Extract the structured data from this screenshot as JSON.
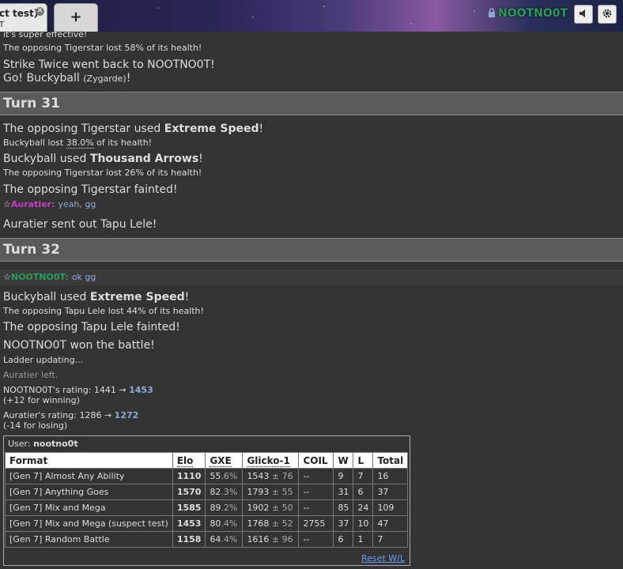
{
  "tabs": {
    "active_title": "ct test)",
    "active_sub": "T",
    "plus": "+"
  },
  "header": {
    "username": "NOOTNO0T",
    "sound_icon": "speaker-icon",
    "settings_icon": "gear-icon",
    "user_color": "#2a9a5a"
  },
  "log": {
    "l0": "it's super effective!",
    "l1": "The opposing Tigerstar lost 58% of its health!",
    "l2": "Strike Twice went back to NOOTNO0T!",
    "l3a": "Go! Buckyball ",
    "l3b": "(Zygarde)",
    "l3c": "!",
    "turn31": "Turn 31",
    "l4a": "The opposing Tigerstar used ",
    "l4b": "Extreme Speed",
    "l4c": "!",
    "l5a": "Buckyball lost ",
    "l5b": "38.0%",
    "l5c": " of its health!",
    "l6a": "Buckyball used ",
    "l6b": "Thousand Arrows",
    "l6c": "!",
    "l7": "The opposing Tigerstar lost 26% of its health!",
    "l8": "The opposing Tigerstar fainted!",
    "chat1": {
      "star": "☆",
      "name": "Auratier:",
      "msg": "yeah, gg",
      "color": "#c040c0"
    },
    "l9": "Auratier sent out Tapu Lele!",
    "turn32": "Turn 32",
    "chat2": {
      "star": "☆",
      "name": "NOOTNO0T:",
      "msg": "ok gg",
      "color": "#2a9a5a"
    },
    "l10a": "Buckyball used ",
    "l10b": "Extreme Speed",
    "l10c": "!",
    "l11": "The opposing Tapu Lele lost 44% of its health!",
    "l12": "The opposing Tapu Lele fainted!",
    "l13": "NOOTNO0T won the battle!",
    "l14": "Ladder updating...",
    "l15": "Auratier left.",
    "r1a": "NOOTNO0T's rating: 1441 → ",
    "r1b": "1453",
    "r1c": "(+12 for winning)",
    "r2a": "Auratier's rating: 1286 → ",
    "r2b": "1272",
    "r2c": "(-14 for losing)"
  },
  "ladder": {
    "user_label": "User: ",
    "user_name": "nootno0t",
    "headers": [
      "Format",
      "Elo",
      "GXE",
      "Glicko-1",
      "COIL",
      "W",
      "L",
      "Total"
    ],
    "rows": [
      {
        "format": "[Gen 7] Almost Any Ability",
        "elo": "1110",
        "gxe_a": "55",
        "gxe_b": ".6%",
        "g_a": "1543",
        "g_b": " ± 76",
        "coil": "--",
        "w": "9",
        "l": "7",
        "total": "16"
      },
      {
        "format": "[Gen 7] Anything Goes",
        "elo": "1570",
        "gxe_a": "82",
        "gxe_b": ".3%",
        "g_a": "1793",
        "g_b": " ± 55",
        "coil": "--",
        "w": "31",
        "l": "6",
        "total": "37"
      },
      {
        "format": "[Gen 7] Mix and Mega",
        "elo": "1585",
        "gxe_a": "89",
        "gxe_b": ".2%",
        "g_a": "1902",
        "g_b": " ± 50",
        "coil": "--",
        "w": "85",
        "l": "24",
        "total": "109"
      },
      {
        "format": "[Gen 7] Mix and Mega (suspect test)",
        "elo": "1453",
        "gxe_a": "80",
        "gxe_b": ".4%",
        "g_a": "1768",
        "g_b": " ± 52",
        "coil": "2755",
        "w": "37",
        "l": "10",
        "total": "47"
      },
      {
        "format": "[Gen 7] Random Battle",
        "elo": "1158",
        "gxe_a": "64",
        "gxe_b": ".4%",
        "g_a": "1616",
        "g_b": " ± 96",
        "coil": "--",
        "w": "6",
        "l": "1",
        "total": "7"
      }
    ],
    "reset": "Reset W/L"
  }
}
